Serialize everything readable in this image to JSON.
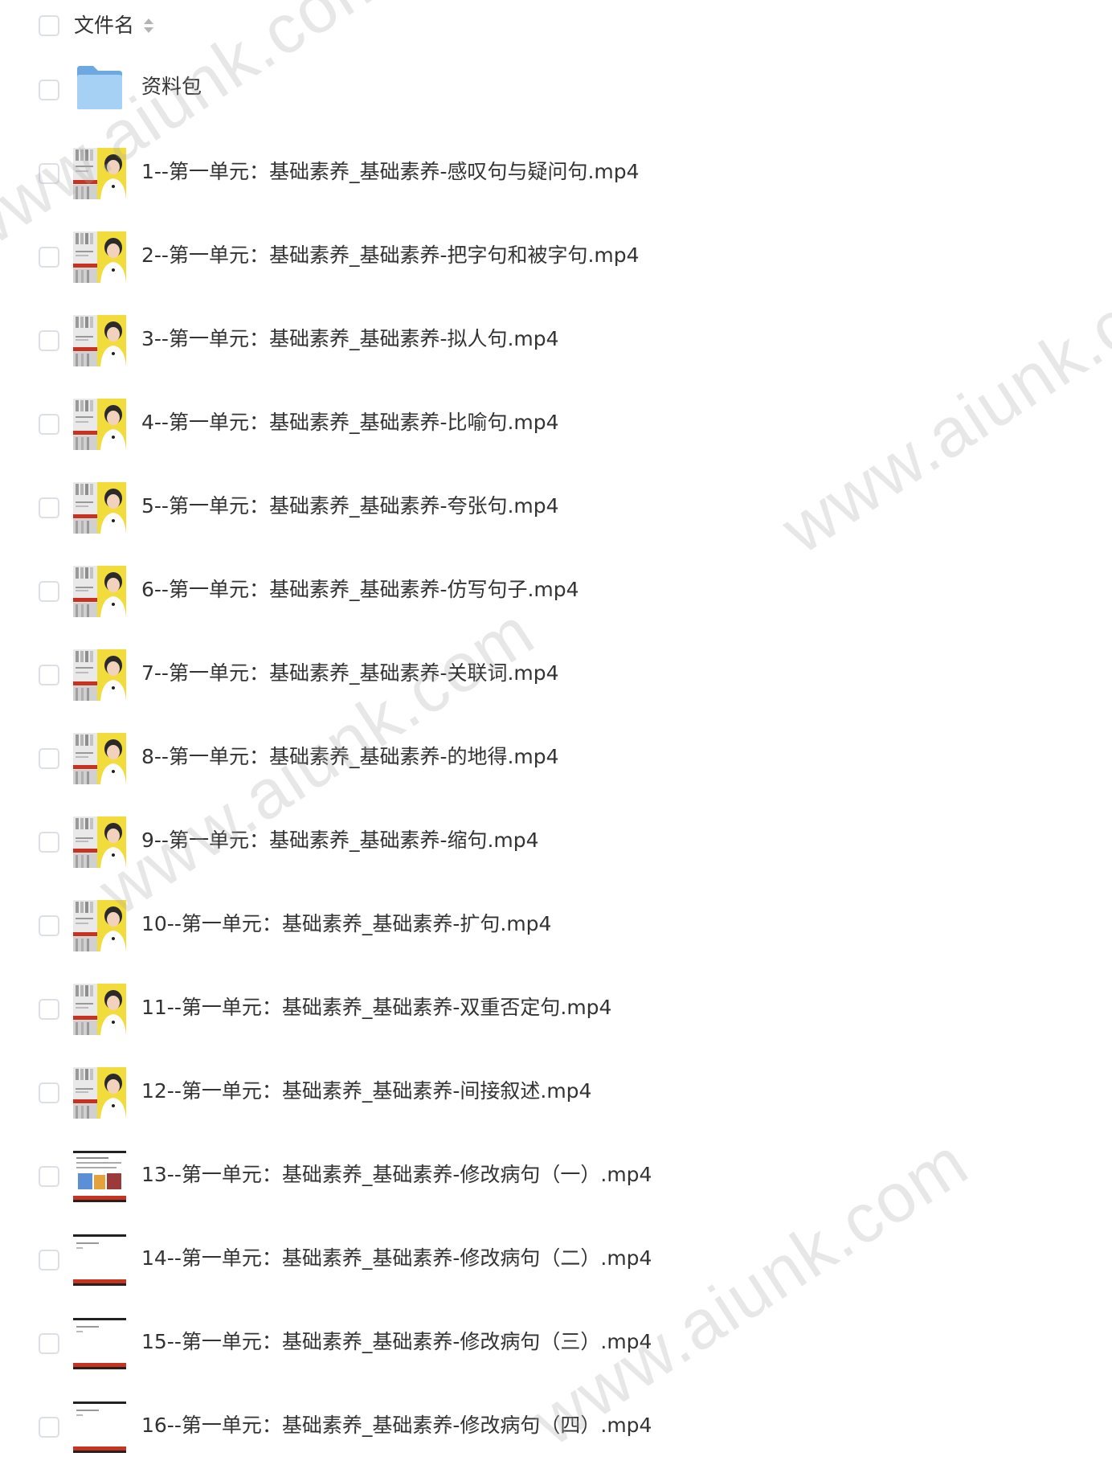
{
  "header": {
    "column_label": "文件名"
  },
  "folder": {
    "name": "资料包",
    "icon": "folder-icon",
    "color": "#7fb8ec"
  },
  "files": [
    {
      "name": "1--第一单元：基础素养_基础素养-感叹句与疑问句.mp4",
      "thumb": "teacher-video"
    },
    {
      "name": "2--第一单元：基础素养_基础素养-把字句和被字句.mp4",
      "thumb": "teacher-video"
    },
    {
      "name": "3--第一单元：基础素养_基础素养-拟人句.mp4",
      "thumb": "teacher-video"
    },
    {
      "name": "4--第一单元：基础素养_基础素养-比喻句.mp4",
      "thumb": "teacher-video"
    },
    {
      "name": "5--第一单元：基础素养_基础素养-夸张句.mp4",
      "thumb": "teacher-video"
    },
    {
      "name": "6--第一单元：基础素养_基础素养-仿写句子.mp4",
      "thumb": "teacher-video"
    },
    {
      "name": "7--第一单元：基础素养_基础素养-关联词.mp4",
      "thumb": "teacher-video"
    },
    {
      "name": "8--第一单元：基础素养_基础素养-的地得.mp4",
      "thumb": "teacher-video"
    },
    {
      "name": "9--第一单元：基础素养_基础素养-缩句.mp4",
      "thumb": "teacher-video"
    },
    {
      "name": "10--第一单元：基础素养_基础素养-扩句.mp4",
      "thumb": "teacher-video"
    },
    {
      "name": "11--第一单元：基础素养_基础素养-双重否定句.mp4",
      "thumb": "teacher-video"
    },
    {
      "name": "12--第一单元：基础素养_基础素养-间接叙述.mp4",
      "thumb": "teacher-video"
    },
    {
      "name": "13--第一单元：基础素养_基础素养-修改病句（一）.mp4",
      "thumb": "slide-pictures"
    },
    {
      "name": "14--第一单元：基础素养_基础素养-修改病句（二）.mp4",
      "thumb": "slide-blank"
    },
    {
      "name": "15--第一单元：基础素养_基础素养-修改病句（三）.mp4",
      "thumb": "slide-blank"
    },
    {
      "name": "16--第一单元：基础素养_基础素养-修改病句（四）.mp4",
      "thumb": "slide-blank"
    }
  ],
  "watermarks": [
    "www.aiunk.com",
    "www.aiunk.com",
    "www.aiunk.com",
    "www.aiunk.com"
  ],
  "colors": {
    "text": "#333333",
    "checkbox_border": "#dcdfe6",
    "thumb_yellow": "#f2dc3c",
    "thumb_red": "#c8321e",
    "watermark": "#aaaaaa"
  }
}
